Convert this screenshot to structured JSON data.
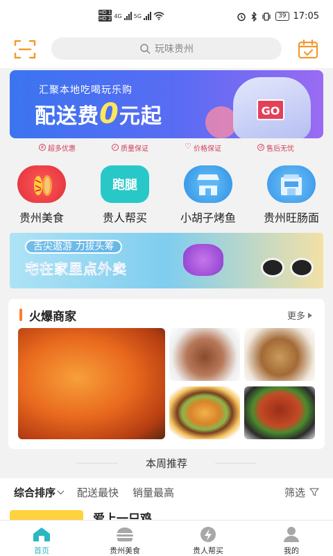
{
  "status_bar": {
    "hd1": "HD 1",
    "hd2": "HD 2",
    "net1": "4G",
    "net2": "5G",
    "battery": "39",
    "time": "17:05"
  },
  "header": {
    "search_placeholder": "玩味贵州",
    "scan_icon": "scan-icon",
    "calendar_icon": "calendar-check-icon"
  },
  "banner": {
    "subtitle": "汇聚本地吃喝玩乐购",
    "main_prefix": "配送费",
    "main_zero": "0",
    "main_suffix": "元起",
    "go": "GO"
  },
  "guarantees": [
    {
      "label": "超多优惠",
      "icon": "discount-icon"
    },
    {
      "label": "质量保证",
      "icon": "quality-icon"
    },
    {
      "label": "价格保证",
      "icon": "heart-icon"
    },
    {
      "label": "售后无忧",
      "icon": "aftersales-icon"
    }
  ],
  "categories": [
    {
      "label": "贵州美食",
      "icon": "food-icon"
    },
    {
      "label": "贵人帮买",
      "icon": "errand-icon",
      "badge": "跑腿"
    },
    {
      "label": "小胡子烤鱼",
      "icon": "shop-icon"
    },
    {
      "label": "贵州旺肠面",
      "icon": "store-icon"
    }
  ],
  "banner2": {
    "tag": "舌尖遨游 力拔头筹",
    "main": "宅在家里点外卖"
  },
  "hot": {
    "title": "火爆商家",
    "more": "更多"
  },
  "weekly": "本周推荐",
  "sort": {
    "comprehensive": "综合排序",
    "fastest": "配送最快",
    "top_sales": "销量最高",
    "filter": "筛选"
  },
  "store_peek": {
    "name": "爱上一只鸡"
  },
  "tabs": [
    {
      "label": "首页",
      "icon": "home-icon",
      "active": true
    },
    {
      "label": "贵州美食",
      "icon": "burger-icon",
      "active": false
    },
    {
      "label": "贵人帮买",
      "icon": "lightning-icon",
      "active": false
    },
    {
      "label": "我的",
      "icon": "user-icon",
      "active": false
    }
  ],
  "colors": {
    "accent": "#2cb7c0",
    "orange": "#ff7b2e",
    "promo_red": "#d1425a"
  }
}
